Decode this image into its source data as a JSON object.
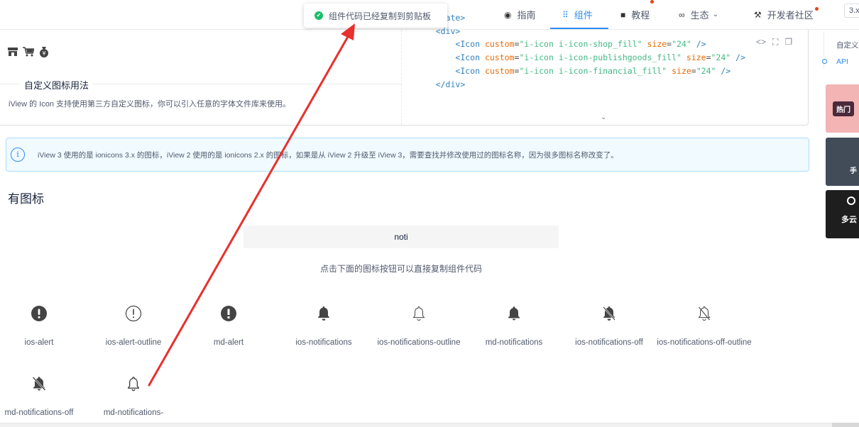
{
  "nav": {
    "items": [
      {
        "id": "guide",
        "label": "指南",
        "icon": "compass-icon"
      },
      {
        "id": "component",
        "label": "组件",
        "icon": "grid-icon",
        "active": true
      },
      {
        "id": "tutorial",
        "label": "教程",
        "icon": "video-icon"
      },
      {
        "id": "ecosystem",
        "label": "生态",
        "icon": "infinity-icon"
      },
      {
        "id": "dev",
        "label": "开发者社区",
        "icon": "tools-icon"
      }
    ],
    "version": "3.x"
  },
  "toast": {
    "text": "组件代码已经复制到剪贴板"
  },
  "demo": {
    "legend": "自定义图标用法",
    "desc": "iView 的 Icon 支持使用第三方自定义图标，你可以引入任意的字体文件库来使用。",
    "icons": [
      "shop-icon",
      "cart-icon",
      "money-bag-icon"
    ]
  },
  "code": {
    "l1_tag": "<template>",
    "l2_tag": "<div>",
    "rows": [
      {
        "tag": "<Icon",
        "attr1": "custom",
        "val1": "\"i-icon i-icon-shop_fill\"",
        "attr2": "size",
        "val2": "\"24\"",
        "close": "/>"
      },
      {
        "tag": "<Icon",
        "attr1": "custom",
        "val1": "\"i-icon i-icon-publishgoods_fill\"",
        "attr2": "size",
        "val2": "\"24\"",
        "close": "/>"
      },
      {
        "tag": "<Icon",
        "attr1": "custom",
        "val1": "\"i-icon i-icon-financial_fill\"",
        "attr2": "size",
        "val2": "\"24\"",
        "close": "/>"
      }
    ],
    "l_end_tag": "</div>",
    "eq": "="
  },
  "alert": {
    "text": "iView 3 使用的是 ionicons 3.x 的图标，iView 2 使用的是 ionicons 2.x 的图标，如果是从 iView 2 升级至 iView 3，需要查找并修改使用过的图标名称，因为很多图标名称改变了。"
  },
  "section": {
    "title": "有图标"
  },
  "search": {
    "value": "noti"
  },
  "hint": "点击下面的图标按钮可以直接复制组件代码",
  "icons": [
    {
      "label": "ios-alert"
    },
    {
      "label": "ios-alert-outline"
    },
    {
      "label": "md-alert"
    },
    {
      "label": "ios-notifications"
    },
    {
      "label": "ios-notifications-outline"
    },
    {
      "label": "md-notifications"
    },
    {
      "label": "ios-notifications-off"
    },
    {
      "label": "ios-notifications-off-outline"
    },
    {
      "label": "md-notifications-off"
    },
    {
      "label": "md-notifications-"
    }
  ],
  "sidebar": {
    "link1": "自定义图标用法",
    "link2": "API",
    "ad1": "热门",
    "ad2": "手",
    "ad3": "多云"
  }
}
